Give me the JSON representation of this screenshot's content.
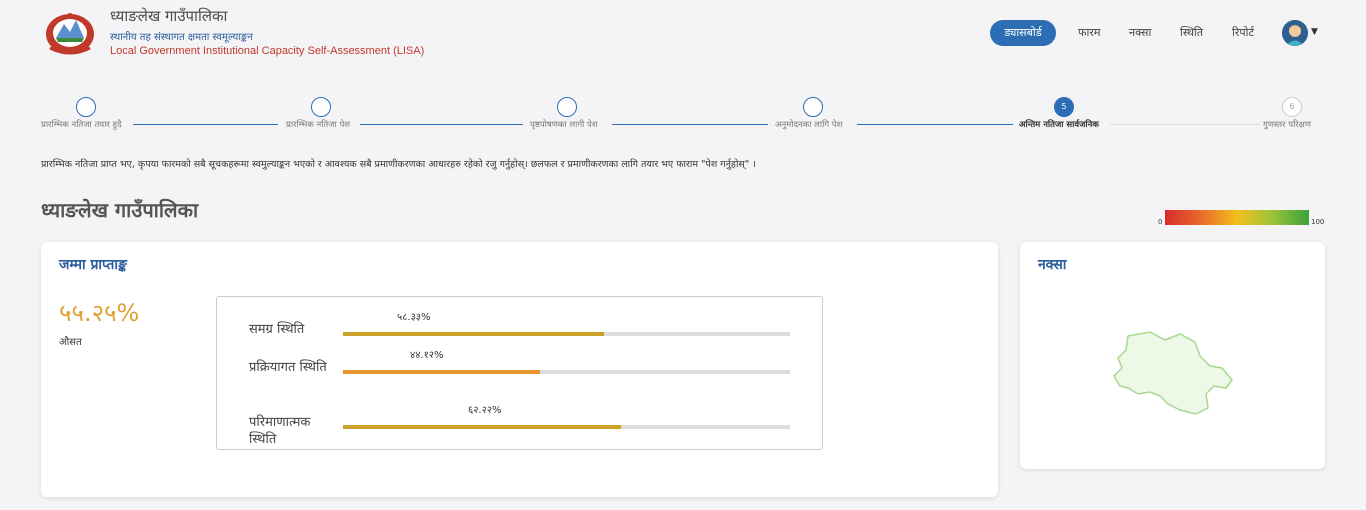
{
  "header": {
    "title": "ध्याङलेख गाउँपालिका",
    "subtitle": "स्थानीय तह संस्थागत क्षमता स्वमूल्याङ्कन",
    "subtitle_en": "Local Government Institutional Capacity Self-Assessment (LISA)"
  },
  "nav": {
    "dashboard": "ड्यासबोर्ड",
    "form": "फारम",
    "map": "नक्सा",
    "status": "स्थिति",
    "report": "रिपोर्ट"
  },
  "stepper": {
    "steps": [
      {
        "number": "",
        "label": "प्रारम्भिक नतिजा तयार हुदै",
        "state": "done"
      },
      {
        "number": "",
        "label": "प्रारम्भिक नतिजा पेश",
        "state": "done"
      },
      {
        "number": "",
        "label": "पृष्ठपोषणका लागी पेश",
        "state": "done"
      },
      {
        "number": "",
        "label": "अनुमोदनका लागि पेश",
        "state": "done"
      },
      {
        "number": "5",
        "label": "अन्तिम नतिजा सार्वजनिक",
        "state": "active"
      },
      {
        "number": "6",
        "label": "गुणस्तर परिक्षण",
        "state": "future"
      }
    ]
  },
  "instruction": "प्रारम्भिक नतिजा प्राप्त भए, कृपया फारमको सबै सूचकहरूमा स्वमुल्याङ्कन भएको र आवश्यक सबै प्रमाणीकरणका आधारहरु रहेको रजु गर्नुहोस्। छलफल र प्रमाणीकरणका लागि तयार भए फाराम \"पेश गर्नुहोस्\" ।",
  "page_title": "ध्याङलेख गाउँपालिका",
  "legend": {
    "min": "0",
    "max": "100"
  },
  "score_card": {
    "title": "जम्मा प्राप्ताङ्क",
    "total": "५५.२५%",
    "total_label": "औसत",
    "bars": [
      {
        "label": "समग्र स्थिति",
        "value_text": "५८.३३%",
        "value": 58.33,
        "color": "#c9a227"
      },
      {
        "label": "प्रक्रियागत स्थिति",
        "value_text": "४४.१२%",
        "value": 44.12,
        "color": "#e8962e"
      },
      {
        "label": "परिमाणात्मक स्थिति",
        "value_text": "६२.२२%",
        "value": 62.22,
        "color": "#c9a227"
      }
    ]
  },
  "map_card": {
    "title": "नक्सा"
  }
}
